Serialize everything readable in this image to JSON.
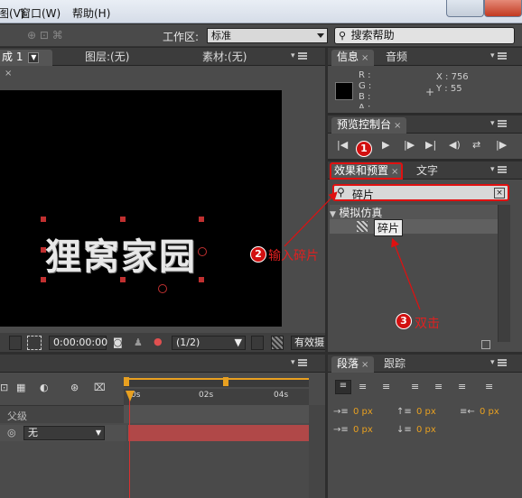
{
  "menu": {
    "items": [
      "图(V)",
      "窗口(W)",
      "帮助(H)"
    ]
  },
  "toolbar": {
    "workspace_label": "工作区:",
    "workspace_value": "标准",
    "search_placeholder": "搜索帮助"
  },
  "comp_tabs": {
    "comp_label": "成 1",
    "layer_label": "图层:(无)",
    "footage_label": "素材:(无)"
  },
  "canvas": {
    "text": "狸窝家园"
  },
  "info_panel": {
    "tabs": [
      "信息",
      "音频"
    ],
    "r": "R :",
    "g": "G :",
    "b": "B :",
    "a": "A :",
    "x": "X : 756",
    "y": "Y : 55"
  },
  "preview_panel": {
    "title": "预览控制台"
  },
  "effects_panel": {
    "tabs": [
      "效果和预置",
      "文字"
    ],
    "search_value": "碎片",
    "category": "模拟仿真",
    "item": "碎片"
  },
  "annotations": {
    "step1": "1",
    "step2": "2",
    "step2_text": "输入碎片",
    "step3": "3",
    "step3_text": "双击"
  },
  "viewer_bar": {
    "timecode": "0:00:00:00",
    "resolution": "(1/2)",
    "view_label": "有效摄"
  },
  "timeline": {
    "ticks": [
      "0s",
      "02s",
      "04s"
    ],
    "parent_label": "父级",
    "parent_value": "无"
  },
  "paragraph_panel": {
    "tabs": [
      "段落",
      "跟踪"
    ],
    "values": [
      "0 px",
      "0 px",
      "0 px",
      "0 px",
      "0 px"
    ]
  },
  "colors": {
    "accent_red": "#e01010",
    "highlight_orange": "#e8a020",
    "layer_bar": "#b04848"
  }
}
